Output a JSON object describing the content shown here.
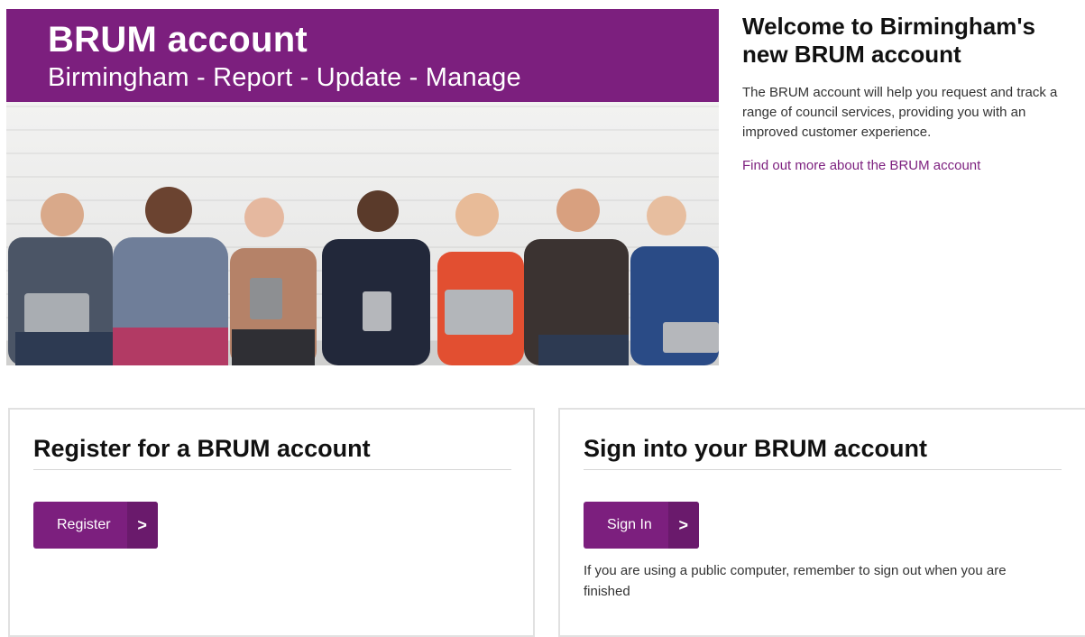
{
  "hero": {
    "title": "BRUM account",
    "subtitle": "Birmingham - Report - Update - Manage"
  },
  "welcome": {
    "heading": "Welcome to Birmingham's new BRUM account",
    "body": "The BRUM account will help you request and track a range of council services, providing you with an improved customer experience.",
    "link": "Find out more about the BRUM account"
  },
  "register": {
    "heading": "Register for a BRUM account",
    "button": "Register",
    "button_chevron": ">"
  },
  "signin": {
    "heading": "Sign into your BRUM account",
    "button": "Sign In",
    "button_chevron": ">",
    "note": "If you are using a public computer,  remember to sign out when you are finished"
  },
  "colors": {
    "brand_purple": "#7c1f7e"
  }
}
